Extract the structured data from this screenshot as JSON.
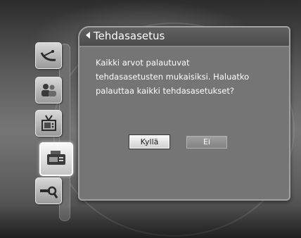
{
  "dialog": {
    "title": "Tehdasasetus",
    "message_lines": [
      "Kaikki arvot palautuvat",
      "tehdasasetusten mukaisiksi. Haluatko",
      "palauttaa kaikki tehdasasetukset?"
    ],
    "buttons": {
      "yes_label": "Kyllä",
      "no_label": "Ei"
    },
    "focused_button": "yes"
  },
  "sidebar": {
    "items": [
      {
        "icon": "satellite-dish-icon",
        "active": false
      },
      {
        "icon": "users-icon",
        "active": false
      },
      {
        "icon": "tv-antenna-icon",
        "active": false
      },
      {
        "icon": "receiver-box-icon",
        "active": true
      },
      {
        "icon": "key-search-icon",
        "active": false
      }
    ]
  },
  "colors": {
    "dialog_bg": "#757575",
    "title_bar_bg": "#555555",
    "text": "#ffffff",
    "focused_button_bg": "#e8e8e8",
    "button_bg": "#909090"
  }
}
